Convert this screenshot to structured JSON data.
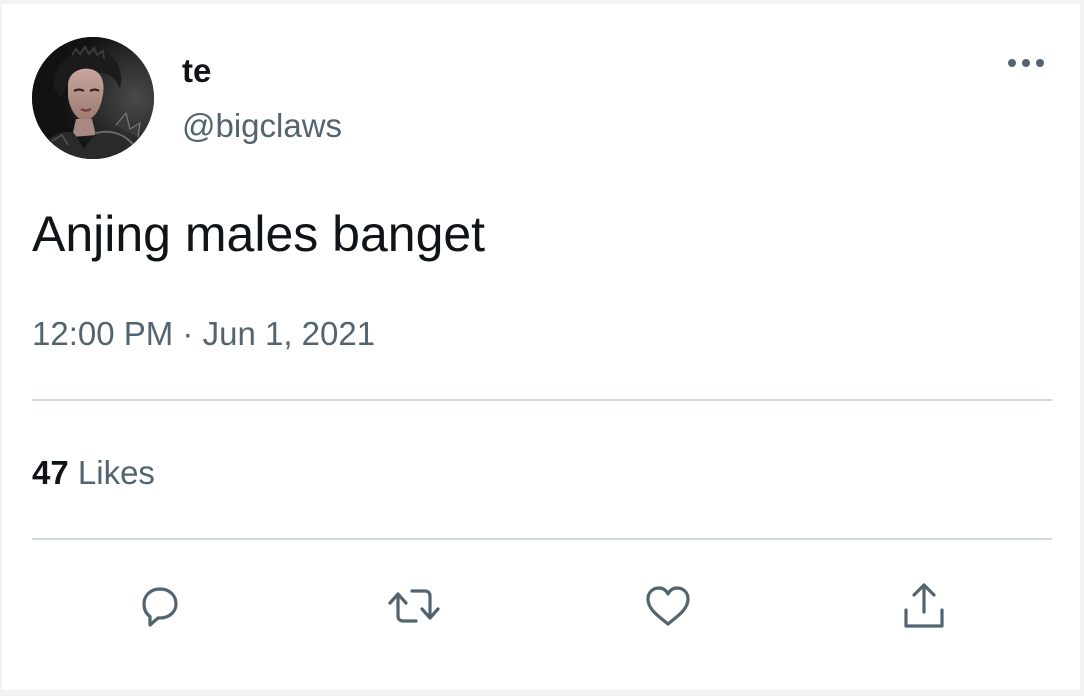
{
  "tweet": {
    "display_name": "te",
    "handle": "@bigclaws",
    "text": "Anjing males banget",
    "time": "12:00 PM",
    "separator": "·",
    "date": "Jun 1, 2021",
    "likes_count": "47",
    "likes_label": "Likes"
  },
  "icons": {
    "more": "more-options-icon",
    "reply": "reply-icon",
    "retweet": "retweet-icon",
    "like": "heart-icon",
    "share": "share-icon"
  },
  "colors": {
    "text_primary": "#0f1419",
    "text_secondary": "#536471",
    "divider": "#cfd9de",
    "icon": "#536471"
  }
}
